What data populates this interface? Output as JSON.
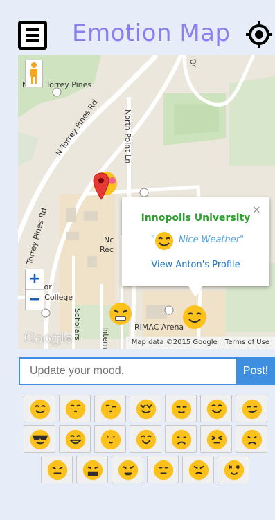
{
  "header": {
    "title": "Emotion Map",
    "menu_icon": "menu-icon",
    "locate_icon": "crosshair-icon"
  },
  "map": {
    "labels": {
      "north_torrey_pines": "North Torrey Pines",
      "n_torrey_pines_rd": "N Torrey Pines Rd",
      "north_point_ln": "North Point Ln",
      "torrey_pines_rd": "Torrey Pines Rd",
      "dr": "Dr",
      "eleanor": "leanor",
      "roosevelt_college": "velt College",
      "rimac": "RIMAC Arena",
      "scholars": "Scholars",
      "intern": "Intern",
      "nc": "Nc",
      "rec": "Rec"
    },
    "zoom_in": "+",
    "zoom_out": "−",
    "attribution": "Map data ©2015 Google",
    "terms": "Terms of Use",
    "google_logo": "Google",
    "info_window": {
      "title": "Innopolis University",
      "mood_text": "Nice Weather\"",
      "quote_open": "\"",
      "link": "View Anton's Profile",
      "close": "×"
    }
  },
  "mood_form": {
    "placeholder": "Update your mood.",
    "post_label": "Post!"
  },
  "emoji_icons": [
    "smiling-face-icon",
    "kissing-face-icon",
    "blowing-kiss-face-icon",
    "heart-eyes-face-icon",
    "relieved-face-icon",
    "grinning-sweat-face-icon",
    "smirking-face-icon",
    "sunglasses-face-icon",
    "grinning-face-icon",
    "raised-hand-face-icon",
    "yummy-face-icon",
    "frowning-face-icon",
    "confounded-face-icon",
    "worried-face-icon",
    "persevering-face-icon",
    "grimacing-face-icon",
    "angry-face-icon",
    "unamused-face-icon",
    "pouting-face-icon",
    "dizzy-face-icon"
  ],
  "colors": {
    "title": "#8a7ff0",
    "accent": "#3f8fe0",
    "info_title": "#2aa12a",
    "emoji_face": "#fcc21b"
  }
}
